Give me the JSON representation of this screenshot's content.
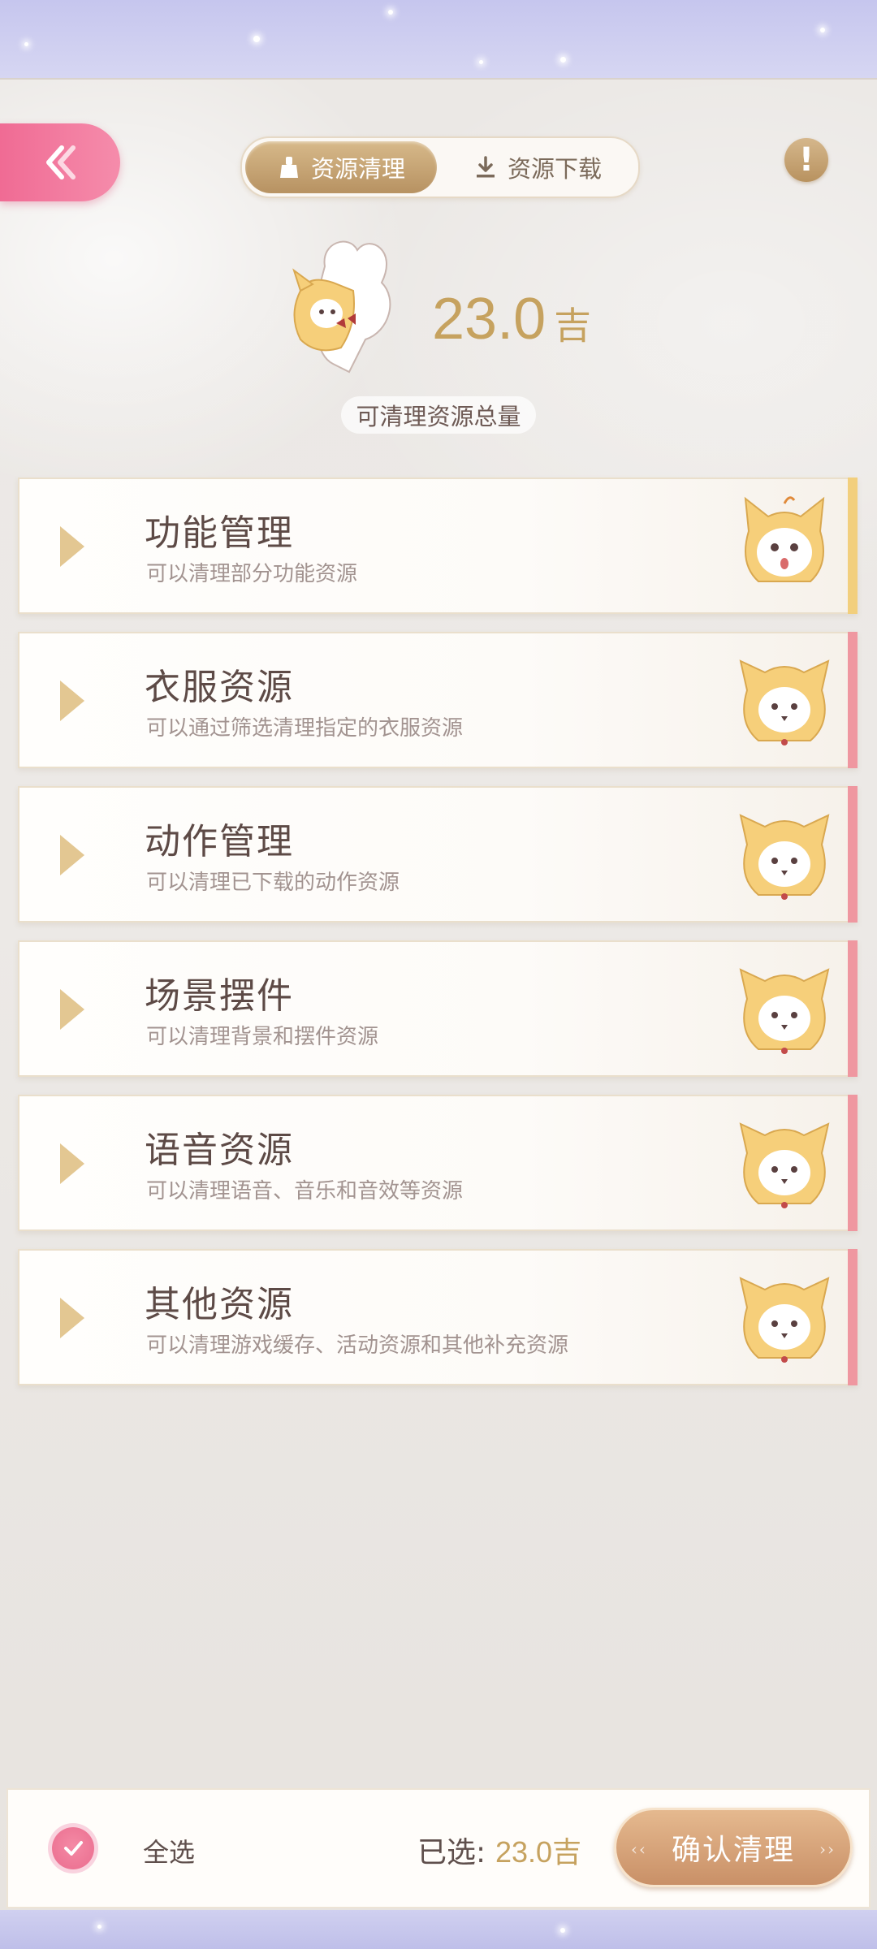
{
  "header": {
    "tabs": [
      {
        "label": "资源清理",
        "active": true,
        "icon": "broom-icon"
      },
      {
        "label": "资源下载",
        "active": false,
        "icon": "download-icon"
      }
    ],
    "info_icon": "!"
  },
  "summary": {
    "total_value": "23.0",
    "total_unit": "吉",
    "label": "可清理资源总量"
  },
  "categories": [
    {
      "title": "功能管理",
      "desc": "可以清理部分功能资源",
      "accent": "#f2cf7d"
    },
    {
      "title": "衣服资源",
      "desc": "可以通过筛选清理指定的衣服资源",
      "accent": "#ef97a0"
    },
    {
      "title": "动作管理",
      "desc": "可以清理已下载的动作资源",
      "accent": "#ef97a0"
    },
    {
      "title": "场景摆件",
      "desc": "可以清理背景和摆件资源",
      "accent": "#ef97a0"
    },
    {
      "title": "语音资源",
      "desc": "可以清理语音、音乐和音效等资源",
      "accent": "#ef97a0"
    },
    {
      "title": "其他资源",
      "desc": "可以清理游戏缓存、活动资源和其他补充资源",
      "accent": "#ef97a0"
    }
  ],
  "footer": {
    "select_all_label": "全选",
    "selected_label": "已选:",
    "selected_value": "23.0吉",
    "confirm_label": "确认清理"
  },
  "colors": {
    "accent_gold": "#c6a25f",
    "accent_pink": "#f06b94",
    "text_dark": "#5d4a46"
  }
}
